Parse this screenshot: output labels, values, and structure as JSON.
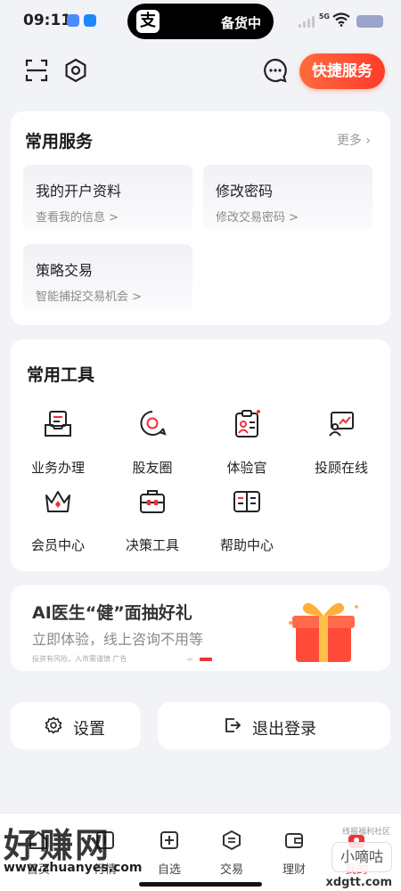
{
  "status_bar": {
    "time": "09:11",
    "island_logo": "支",
    "island_text": "备货中",
    "network": "5G",
    "battery_color": "#9aa4c8"
  },
  "topbar": {
    "scan_icon": "scan-icon",
    "settings_icon": "hexagon-settings-icon",
    "chat_icon": "chat-bubble-icon",
    "quick_service_label": "快捷服务"
  },
  "services": {
    "title": "常用服务",
    "more_label": "更多",
    "items": [
      {
        "title": "我的开户资料",
        "sub": "查看我的信息 >"
      },
      {
        "title": "修改密码",
        "sub": "修改交易密码 >"
      },
      {
        "title": "策略交易",
        "sub": "智能捕捉交易机会 >"
      }
    ]
  },
  "tools": {
    "title": "常用工具",
    "items": [
      {
        "label": "业务办理",
        "icon": "inbox-tray-icon"
      },
      {
        "label": "股友圈",
        "icon": "circle-chat-icon"
      },
      {
        "label": "体验官",
        "icon": "clipboard-user-icon"
      },
      {
        "label": "投顾在线",
        "icon": "advisor-chart-icon"
      },
      {
        "label": "会员中心",
        "icon": "crown-icon"
      },
      {
        "label": "决策工具",
        "icon": "toolbox-icon"
      },
      {
        "label": "帮助中心",
        "icon": "open-book-icon"
      }
    ]
  },
  "banner": {
    "title": "AI医生“健”面抽好礼",
    "subtitle": "立即体验，线上咨询不用等",
    "note": "投资有风险，入市需谨慎 广告",
    "icon": "gift-box-icon"
  },
  "actions": {
    "settings_label": "设置",
    "logout_label": "退出登录"
  },
  "tabbar": {
    "items": [
      {
        "label": "首页",
        "icon": "home-icon"
      },
      {
        "label": "行情",
        "icon": "market-icon"
      },
      {
        "label": "自选",
        "icon": "plus-square-icon"
      },
      {
        "label": "交易",
        "icon": "exchange-icon"
      },
      {
        "label": "理财",
        "icon": "wallet-icon"
      },
      {
        "label": "我的",
        "icon": "profile-icon"
      }
    ],
    "active_color": "#f0303a"
  },
  "watermarks": {
    "site_name": "好赚网",
    "site_url": "www.zhuanyes.com",
    "badge_text": "小嘀咕",
    "badge_url": "xdgtt.com",
    "badge_caption": "线报福利社区"
  }
}
